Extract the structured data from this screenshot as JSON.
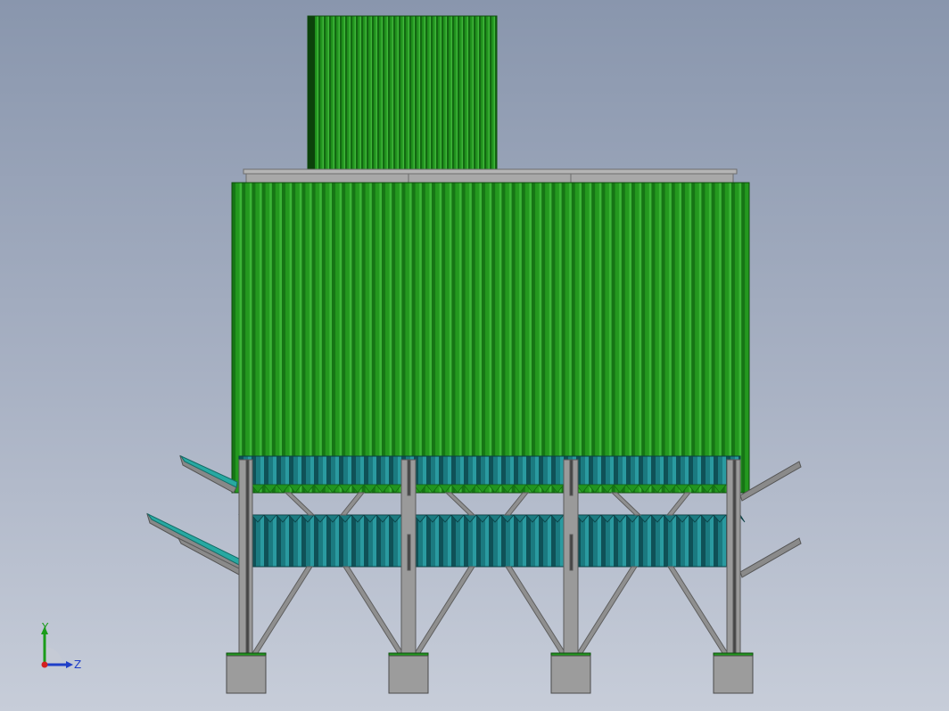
{
  "viewport": {
    "background_top": "#8996ad",
    "background_bottom": "#c7cdd9"
  },
  "triad": {
    "y_label": "Y",
    "z_label": "Z",
    "y_color": "#1a9c1a",
    "z_color": "#1f3fc8",
    "origin_color": "#d42020"
  },
  "model": {
    "body_color": "#22951f",
    "body_dark": "#136912",
    "body_light": "#3fb63a",
    "hopper_color": "#1b7a80",
    "hopper_dark": "#0f5157",
    "steel_color": "#8f8f8f",
    "steel_dark": "#5f5f5f",
    "base_color": "#9c9c9c",
    "inlet_color": "#27a9a2",
    "base_count": 4
  }
}
